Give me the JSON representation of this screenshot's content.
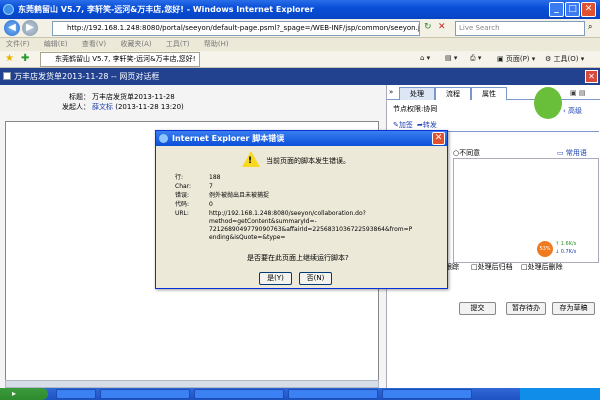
{
  "window": {
    "title": "东莞鹤留山 V5.7, 李轩笑-远河&万丰店,您好! - Windows Internet Explorer",
    "min": "_",
    "max": "□",
    "close": "✕"
  },
  "address": {
    "url": "http://192.168.1.248:8080/portal/seeyon/default-page.psml?_spage=/WEB-INF/jsp/common/seeyon.jsp",
    "search_placeholder": "Live Search"
  },
  "menu": [
    "文件(F)",
    "编辑(E)",
    "查看(V)",
    "收藏夹(A)",
    "工具(T)",
    "帮助(H)"
  ],
  "favorites": {
    "tab_label": "东莞鹤留山 V5.7, 李轩笑-远河&万丰店,您好!",
    "page_menu": "页面(P)",
    "tools_menu": "工具(O)"
  },
  "page": {
    "title": "万丰店发货单2013-11-28 -- 网页对话框"
  },
  "document": {
    "subject_label": "标题：",
    "subject_value": "万丰店发货单2013-11-28",
    "sender_label": "发起人：",
    "sender_value": "薛文标",
    "sender_time": "(2013-11-28 13:20)"
  },
  "panel": {
    "tabs": [
      "处理",
      "流程",
      "属性"
    ],
    "section": "节点权限:协同",
    "high_level": "高级",
    "add_attachment": "加签",
    "transfer": "转发",
    "disagree": "不同意",
    "common_phrases": "常用语",
    "speed_up": "1.6K/s",
    "speed_down": "0.7K/s",
    "badge": "53%",
    "checks": [
      "跟踪",
      "处理后归档",
      "处理后删除"
    ],
    "buttons": [
      "提交",
      "暂存待办",
      "存为草稿"
    ]
  },
  "dialog": {
    "title": "Internet Explorer 脚本错误",
    "message": "当前页面的脚本发生错误。",
    "fields": [
      {
        "label": "行:",
        "value": "188"
      },
      {
        "label": "Char:",
        "value": "7"
      },
      {
        "label": "错误:",
        "value": "例外被抛出且未被捕捉"
      },
      {
        "label": "代码:",
        "value": "0"
      }
    ],
    "url_label": "URL:",
    "url_value_lines": [
      "http://192.168.1.248:8080/seeyon/collaboration.do?",
      "method=getContent&summaryId=-",
      "7212689049779090763&affairId=2256831036722593864&from=P",
      "ending&isQuote=&type="
    ],
    "question": "是否要在此页面上继续运行脚本?",
    "yes": "是(Y)",
    "no": "否(N)"
  }
}
